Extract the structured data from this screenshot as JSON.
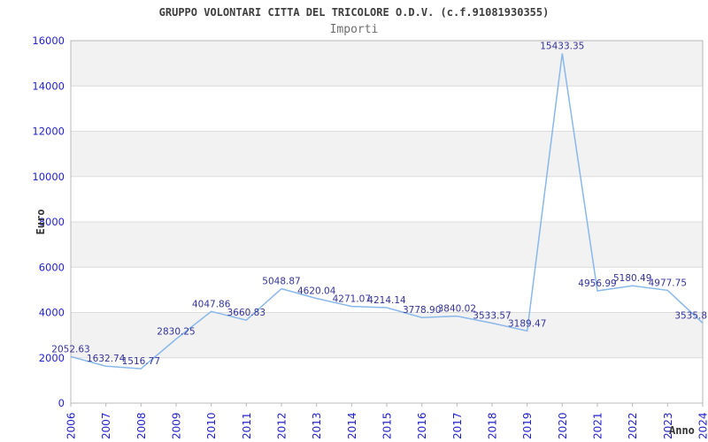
{
  "header": {
    "title": "GRUPPO VOLONTARI CITTA DEL TRICOLORE O.D.V. (c.f.91081930355)",
    "subtitle": "Importi"
  },
  "chart_data": {
    "type": "line",
    "title": "GRUPPO VOLONTARI CITTA DEL TRICOLORE O.D.V. (c.f.91081930355)",
    "subtitle": "Importi",
    "xlabel": "Anno",
    "ylabel": "Euro",
    "categories": [
      "2006",
      "2007",
      "2008",
      "2009",
      "2010",
      "2011",
      "2012",
      "2013",
      "2014",
      "2015",
      "2016",
      "2017",
      "2018",
      "2019",
      "2020",
      "2021",
      "2022",
      "2023",
      "2024"
    ],
    "series": [
      {
        "name": "Importi",
        "values": [
          2052.63,
          1632.74,
          1516.77,
          2830.25,
          4047.86,
          3660.83,
          5048.87,
          4620.04,
          4271.07,
          4214.14,
          3778.9,
          3840.02,
          3533.57,
          3189.47,
          15433.35,
          4956.99,
          5180.49,
          4977.75,
          3535.8
        ]
      }
    ],
    "point_labels": [
      "2052.63",
      "1632.74",
      "1516.77",
      "2830.25",
      "4047.86",
      "3660.83",
      "5048.87",
      "4620.04",
      "4271.07",
      "4214.14",
      "3778.90",
      "3840.02",
      "3533.57",
      "3189.47",
      "15433.35",
      "4956.99",
      "5180.49",
      "4977.75",
      "3535.8"
    ],
    "ylim": [
      0,
      16000
    ],
    "yticks": [
      0,
      2000,
      4000,
      6000,
      8000,
      10000,
      12000,
      14000,
      16000
    ],
    "grid": true,
    "legend": "none",
    "band_fill": "alternating-horizontal"
  },
  "colors": {
    "background": "#ffffff",
    "band": "#f2f2f2",
    "grid": "#dcdcdc",
    "border": "#b8b8b8",
    "line": "#89b8ea",
    "point_label": "#333399",
    "tick_label": "#2222cc",
    "title": "#3d3d3d",
    "subtitle": "#6e6e6e",
    "axis_label": "#333333"
  }
}
